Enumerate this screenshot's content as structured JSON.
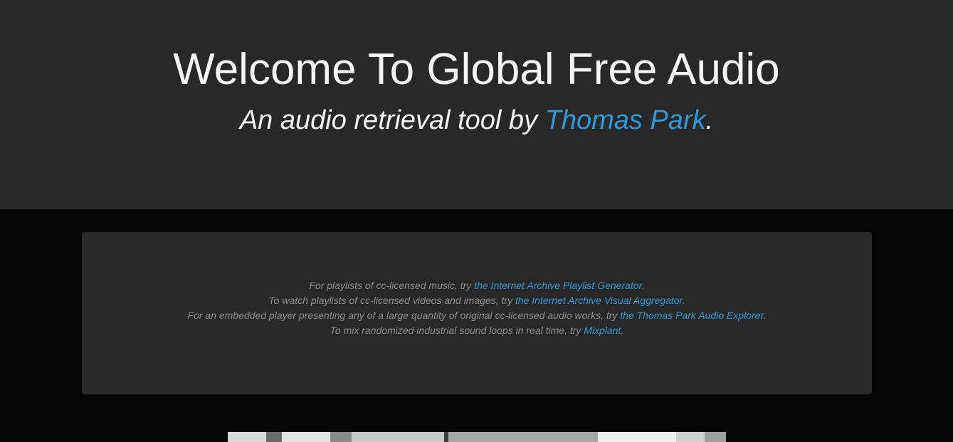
{
  "header": {
    "title": "Welcome To Global Free Audio",
    "subtitle_prefix": "An audio retrieval tool by ",
    "subtitle_link": "Thomas Park",
    "subtitle_suffix": "."
  },
  "info": {
    "lines": [
      {
        "prefix": "For playlists of cc-licensed music, try ",
        "link": "the Internet Archive Playlist Generator",
        "suffix": "."
      },
      {
        "prefix": "To watch playlists of cc-licensed videos and images, try ",
        "link": "the Internet Archive Visual Aggregator",
        "suffix": "."
      },
      {
        "prefix": "For an embedded player presenting any of a large quantity of original cc-licensed audio works, try ",
        "link": "the Thomas Park Audio Explorer",
        "suffix": "."
      },
      {
        "prefix": "To mix randomized industrial sound loops in real time, try ",
        "link": "Mixplant",
        "suffix": "."
      }
    ]
  },
  "colors": {
    "page_bg": "#050505",
    "hero_bg": "#282828",
    "panel_bg": "#282828",
    "link": "#3399d6",
    "muted_text": "#8d8d8d",
    "title_text": "#f4f4f4"
  }
}
